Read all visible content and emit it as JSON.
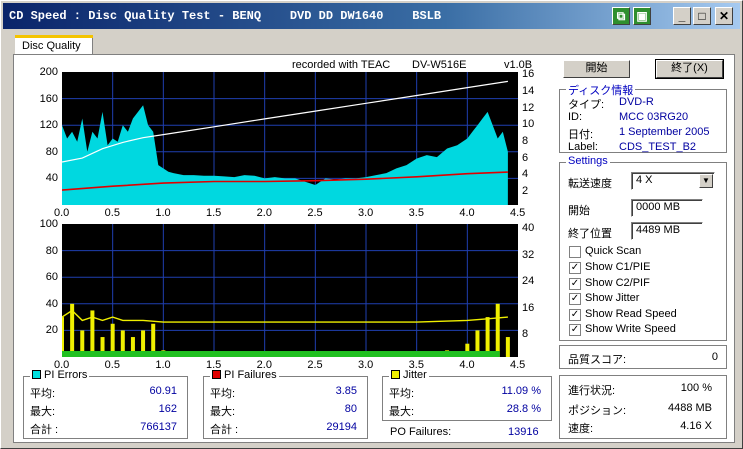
{
  "window": {
    "title": "CD Speed : Disc Quality Test - BENQ    DVD DD DW1640    BSLB"
  },
  "tab": {
    "label": "Disc Quality"
  },
  "chart_header": {
    "recorded_with": "recorded with TEAC",
    "drive": "DV-W516E",
    "version": "v1.0B"
  },
  "buttons": {
    "start": "開始",
    "stop": "終了(X)"
  },
  "disc_info": {
    "title": "ディスク情報",
    "type_label": "タイプ:",
    "type_value": "DVD-R",
    "id_label": "ID:",
    "id_value": "MCC 03RG20",
    "date_label": "日付:",
    "date_value": "1 September 2005",
    "label_label": "Label:",
    "label_value": "CDS_TEST_B2"
  },
  "settings": {
    "title": "Settings",
    "speed_label": "転送速度",
    "speed_value": "4 X",
    "start_label": "開始",
    "start_value": "0000 MB",
    "end_label": "終了位置",
    "end_value": "4489 MB",
    "checkboxes": [
      {
        "label": "Quick Scan",
        "checked": ""
      },
      {
        "label": "Show C1/PIE",
        "checked": "✓"
      },
      {
        "label": "Show C2/PIF",
        "checked": "✓"
      },
      {
        "label": "Show Jitter",
        "checked": "✓"
      },
      {
        "label": "Show Read Speed",
        "checked": "✓"
      },
      {
        "label": "Show Write Speed",
        "checked": "✓"
      }
    ]
  },
  "quality": {
    "label": "品質スコア:",
    "value": "0"
  },
  "progress": {
    "progress_label": "進行状況:",
    "progress_value": "100 %",
    "position_label": "ポジション:",
    "position_value": "4488 MB",
    "speed_label": "速度:",
    "speed_value": "4.16 X"
  },
  "stats": {
    "pi_errors": {
      "title": "PI Errors",
      "color": "#00e0e0",
      "avg_label": "平均:",
      "avg": "60.91",
      "max_label": "最大:",
      "max": "162",
      "total_label": "合計 :",
      "total": "766137"
    },
    "pi_failures": {
      "title": "PI Failures",
      "color": "#e00000",
      "avg_label": "平均:",
      "avg": "3.85",
      "max_label": "最大:",
      "max": "80",
      "total_label": "合計 :",
      "total": "29194"
    },
    "jitter": {
      "title": "Jitter",
      "color": "#f0f000",
      "avg_label": "平均:",
      "avg": "11.09 %",
      "max_label": "最大:",
      "max": "28.8 %"
    },
    "po_failures": {
      "label": "PO Failures:",
      "value": "13916"
    }
  },
  "chart_data": [
    {
      "type": "area",
      "x_ticks": [
        "0.0",
        "0.5",
        "1.0",
        "1.5",
        "2.0",
        "2.5",
        "3.0",
        "3.5",
        "4.0",
        "4.5"
      ],
      "y_left_ticks": [
        "200",
        "160",
        "120",
        "80",
        "40"
      ],
      "y_right_ticks": [
        "16",
        "14",
        "12",
        "10",
        "8",
        "6",
        "4",
        "2"
      ],
      "xlim": [
        0,
        4.5
      ],
      "ylim_left": [
        0,
        200
      ],
      "ylim_right": [
        0,
        17
      ],
      "pie_x": [
        0.0,
        0.05,
        0.1,
        0.15,
        0.2,
        0.25,
        0.3,
        0.35,
        0.4,
        0.45,
        0.5,
        0.55,
        0.6,
        0.65,
        0.7,
        0.75,
        0.8,
        0.85,
        0.9,
        0.95,
        1.0,
        1.05,
        1.1,
        1.2,
        1.3,
        1.4,
        1.5,
        1.6,
        1.7,
        1.8,
        1.9,
        2.0,
        2.1,
        2.2,
        2.3,
        2.4,
        2.5,
        2.6,
        2.7,
        2.8,
        2.9,
        3.0,
        3.1,
        3.2,
        3.3,
        3.4,
        3.5,
        3.6,
        3.7,
        3.8,
        3.9,
        4.0,
        4.05,
        4.1,
        4.15,
        4.2,
        4.25,
        4.3,
        4.35,
        4.4
      ],
      "pie_y": [
        120,
        100,
        110,
        95,
        130,
        80,
        110,
        100,
        140,
        90,
        100,
        95,
        120,
        110,
        130,
        140,
        150,
        120,
        110,
        60,
        55,
        50,
        48,
        45,
        45,
        44,
        44,
        43,
        42,
        45,
        44,
        40,
        42,
        40,
        40,
        35,
        30,
        40,
        38,
        40,
        40,
        42,
        45,
        48,
        55,
        60,
        70,
        75,
        72,
        85,
        90,
        100,
        110,
        120,
        130,
        140,
        120,
        100,
        110,
        80
      ],
      "write_speed_x": [
        0.0,
        0.2,
        0.4,
        0.6,
        0.8,
        1.0,
        1.5,
        2.0,
        2.5,
        3.0,
        3.5,
        4.0,
        4.4
      ],
      "write_speed_y": [
        5.5,
        6.0,
        7.2,
        8.0,
        8.6,
        9.0,
        10.0,
        11.0,
        12.0,
        13.0,
        14.0,
        15.0,
        15.8
      ],
      "read_speed_x": [
        0.0,
        0.5,
        1.0,
        1.5,
        2.0,
        2.5,
        3.0,
        3.5,
        4.0,
        4.4
      ],
      "read_speed_y": [
        1.9,
        2.4,
        2.8,
        3.0,
        3.0,
        3.1,
        3.3,
        3.6,
        4.0,
        4.2
      ]
    },
    {
      "type": "area",
      "x_ticks": [
        "0.0",
        "0.5",
        "1.0",
        "1.5",
        "2.0",
        "2.5",
        "3.0",
        "3.5",
        "4.0",
        "4.5"
      ],
      "y_left_ticks": [
        "100",
        "80",
        "60",
        "40",
        "20"
      ],
      "y_right_ticks": [
        "40",
        "32",
        "24",
        "16",
        "8"
      ],
      "xlim": [
        0,
        4.5
      ],
      "ylim_left": [
        0,
        100
      ],
      "ylim_right": [
        0,
        40
      ],
      "pif_x": [
        0.0,
        0.1,
        0.2,
        0.3,
        0.4,
        0.5,
        0.6,
        0.7,
        0.8,
        0.9,
        1.0,
        1.5,
        2.0,
        2.5,
        3.0,
        3.5,
        3.8,
        4.0,
        4.1,
        4.2,
        4.3,
        4.4
      ],
      "pif_y": [
        30,
        40,
        20,
        35,
        15,
        25,
        20,
        15,
        20,
        25,
        5,
        3,
        2,
        2,
        2,
        3,
        5,
        10,
        20,
        30,
        40,
        15
      ],
      "jitter_x": [
        0.0,
        0.1,
        0.2,
        0.3,
        0.4,
        0.5,
        0.6,
        0.8,
        1.0,
        1.5,
        2.0,
        2.5,
        3.0,
        3.5,
        4.0,
        4.2,
        4.4
      ],
      "jitter_y": [
        12,
        14,
        11,
        12,
        11,
        12,
        11,
        11,
        10.5,
        10.5,
        10.5,
        10.5,
        10.5,
        10.5,
        11,
        11.5,
        12
      ]
    }
  ]
}
